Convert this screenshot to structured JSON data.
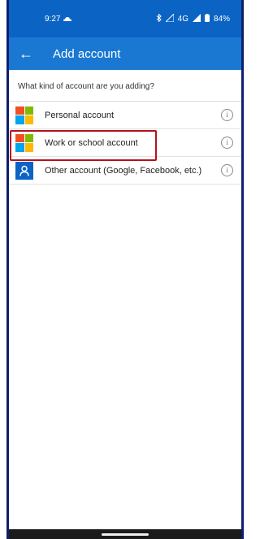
{
  "status": {
    "time": "9:27",
    "cloud_icon": "cloud-icon",
    "signal": "4G",
    "battery": "84%"
  },
  "toolbar": {
    "back_icon": "←",
    "title": "Add account"
  },
  "prompt": "What kind of account are you adding?",
  "accounts": [
    {
      "label": "Personal account",
      "icon": "microsoft-logo-icon"
    },
    {
      "label": "Work or school account",
      "icon": "microsoft-logo-icon",
      "highlighted": true
    },
    {
      "label": "Other account (Google, Facebook, etc.)",
      "icon": "person-icon"
    }
  ],
  "info_glyph": "i",
  "colors": {
    "statusbar": "#0b64c3",
    "toolbar": "#1a78d2",
    "highlight": "#b5121b"
  }
}
